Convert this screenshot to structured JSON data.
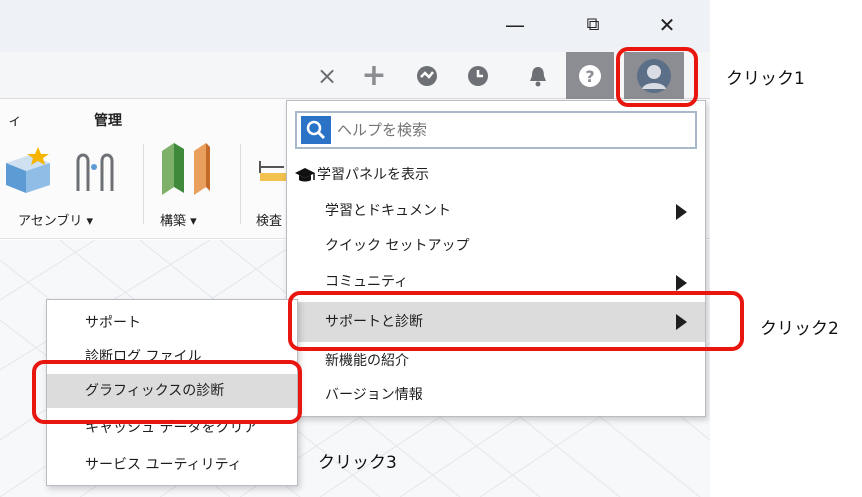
{
  "window_controls": {
    "minimize": "—",
    "restore": "⧉",
    "close": "✕"
  },
  "tabbar": {
    "close_tab": "×",
    "add": "+",
    "icons": [
      "new-tab-icon",
      "online-status-icon",
      "job-status-icon",
      "notifications-icon",
      "help-icon",
      "profile-icon"
    ]
  },
  "ribbon": {
    "tabs": [
      "ィ",
      "管理"
    ],
    "groups": [
      "アセンブリ ▾",
      "構築 ▾",
      "検査"
    ]
  },
  "help_menu": {
    "search_placeholder": "ヘルプを検索",
    "items": [
      {
        "label": "学習パネルを表示"
      },
      {
        "label": "学習とドキュメント",
        "submenu": true
      },
      {
        "label": "クイック セットアップ"
      },
      {
        "label": "コミュニティ",
        "submenu": true
      },
      {
        "label": "サポートと診断",
        "submenu": true,
        "highlighted": true
      },
      {
        "label": "新機能の紹介"
      },
      {
        "label": "バージョン情報"
      }
    ]
  },
  "support_submenu": {
    "items": [
      {
        "label": "サポート"
      },
      {
        "label": "診断ログ ファイル"
      },
      {
        "label": "グラフィックスの診断",
        "highlighted": true
      },
      {
        "label": "キャッシュ データをクリア"
      },
      {
        "label": "サービス ユーティリティ"
      }
    ]
  },
  "annotations": {
    "click1": "クリック1",
    "click2": "クリック2",
    "click3": "クリック3"
  },
  "colors": {
    "callout": "#e8160f",
    "highlight": "#dcdcdc",
    "search_blue": "#2b73c7",
    "profile_bg": "#8b8d92"
  }
}
